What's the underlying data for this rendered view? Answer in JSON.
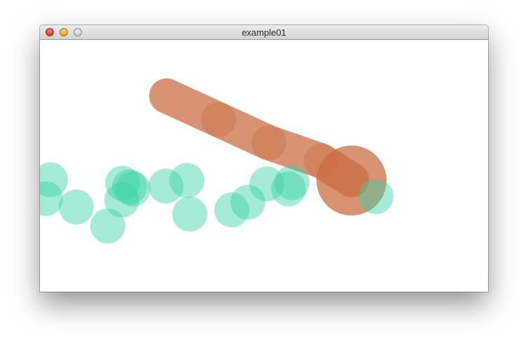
{
  "window": {
    "title": "example01"
  },
  "colors": {
    "trail_circle": "#3ad3a5",
    "trail_circle_opacity": 0.45,
    "stroke": "#c96a3f",
    "stroke_opacity": 0.72,
    "cursor_blob": "#c96a3f"
  },
  "icons": {
    "close": "close-icon",
    "minimize": "minimize-icon",
    "zoom": "zoom-icon"
  }
}
